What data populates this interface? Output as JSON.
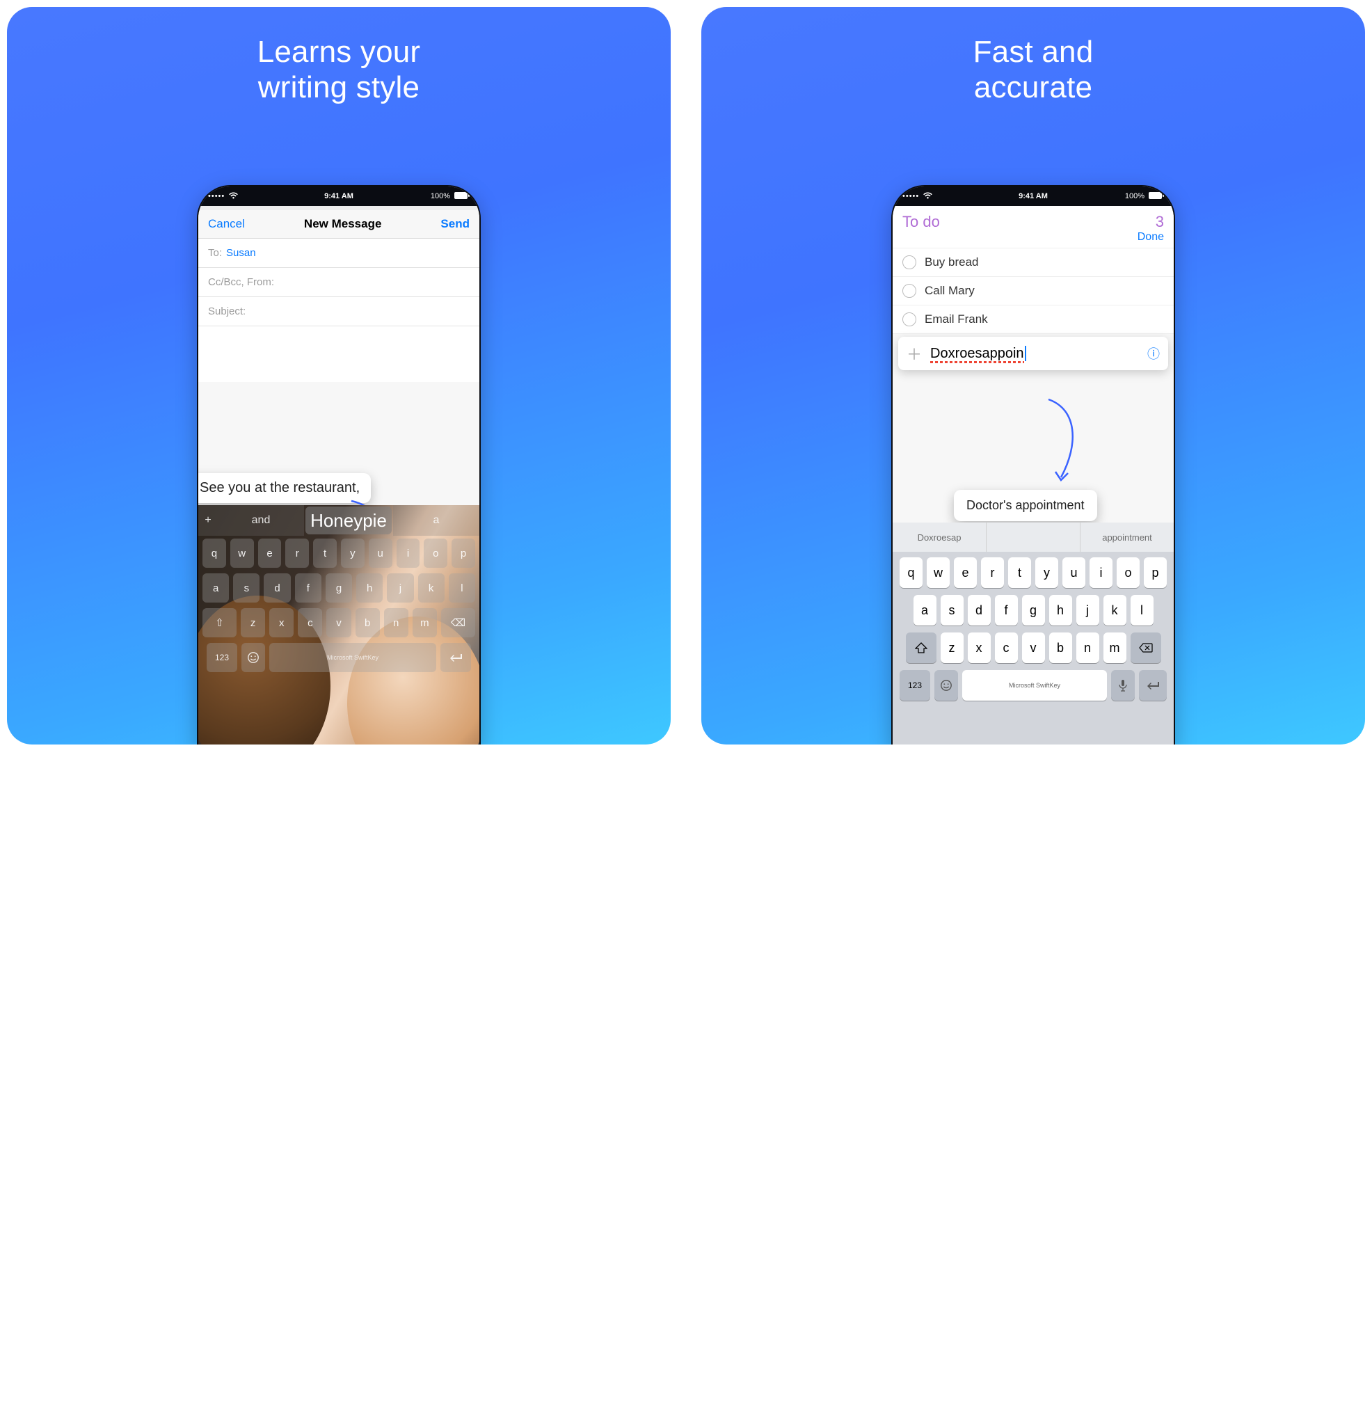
{
  "status": {
    "time": "9:41 AM",
    "battery": "100%"
  },
  "left": {
    "title_line1": "Learns your",
    "title_line2": "writing style",
    "nav": {
      "cancel": "Cancel",
      "title": "New Message",
      "send": "Send"
    },
    "mail": {
      "to_label": "To:",
      "to_value": "Susan",
      "cc_label": "Cc/Bcc, From:",
      "subject_label": "Subject:"
    },
    "bubble_text": "See you at the restaurant,",
    "suggestions": {
      "left": "and",
      "mid": "Honeypie",
      "right": "a"
    },
    "kb": {
      "row1": [
        "q",
        "w",
        "e",
        "r",
        "t",
        "y",
        "u",
        "i",
        "o",
        "p"
      ],
      "row2": [
        "a",
        "s",
        "d",
        "f",
        "g",
        "h",
        "j",
        "k",
        "l"
      ],
      "row3_shift": "⇧",
      "row3": [
        "z",
        "x",
        "c",
        "v",
        "b",
        "n",
        "m"
      ],
      "row3_back": "⌫",
      "n123": "123",
      "branding": "Microsoft SwiftKey"
    }
  },
  "right": {
    "title_line1": "Fast and",
    "title_line2": "accurate",
    "todo": {
      "title": "To do",
      "count": "3",
      "done": "Done",
      "items": [
        "Buy bread",
        "Call Mary",
        "Email Frank"
      ],
      "typed": "Doxroesappoin"
    },
    "correction": "Doctor's appointment",
    "sug_left": "Doxroesap",
    "sug_right": "appointment",
    "kb": {
      "row1": [
        "q",
        "w",
        "e",
        "r",
        "t",
        "y",
        "u",
        "i",
        "o",
        "p"
      ],
      "row2": [
        "a",
        "s",
        "d",
        "f",
        "g",
        "h",
        "j",
        "k",
        "l"
      ],
      "row3": [
        "z",
        "x",
        "c",
        "v",
        "b",
        "n",
        "m"
      ],
      "n123": "123",
      "branding": "Microsoft SwiftKey"
    }
  }
}
